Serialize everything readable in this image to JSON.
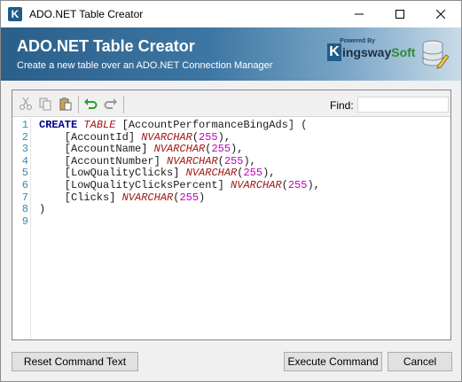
{
  "window": {
    "title": "ADO.NET Table Creator",
    "app_icon_letter": "K"
  },
  "banner": {
    "title": "ADO.NET Table Creator",
    "subtitle": "Create a new table over an ADO.NET Connection Manager",
    "logo_powered_by": "Powered By",
    "logo_brand_k": "K",
    "logo_brand_main": "ingsway",
    "logo_brand_soft": "Soft"
  },
  "toolbar": {
    "icons": [
      "cut-icon",
      "copy-icon",
      "paste-icon",
      "undo-icon",
      "redo-icon"
    ],
    "find_label": "Find:",
    "find_value": ""
  },
  "editor": {
    "line_numbers": [
      "1",
      "2",
      "3",
      "4",
      "5",
      "6",
      "7",
      "8",
      "9"
    ],
    "lines": [
      [
        {
          "t": "CREATE",
          "c": "kw"
        },
        {
          "t": " ",
          "c": ""
        },
        {
          "t": "TABLE",
          "c": "kw2"
        },
        {
          "t": " [AccountPerformanceBingAds] (",
          "c": ""
        }
      ],
      [
        {
          "t": "    [AccountId] ",
          "c": ""
        },
        {
          "t": "NVARCHAR",
          "c": "ty"
        },
        {
          "t": "(",
          "c": ""
        },
        {
          "t": "255",
          "c": "num"
        },
        {
          "t": "),",
          "c": ""
        }
      ],
      [
        {
          "t": "    [AccountName] ",
          "c": ""
        },
        {
          "t": "NVARCHAR",
          "c": "ty"
        },
        {
          "t": "(",
          "c": ""
        },
        {
          "t": "255",
          "c": "num"
        },
        {
          "t": "),",
          "c": ""
        }
      ],
      [
        {
          "t": "    [AccountNumber] ",
          "c": ""
        },
        {
          "t": "NVARCHAR",
          "c": "ty"
        },
        {
          "t": "(",
          "c": ""
        },
        {
          "t": "255",
          "c": "num"
        },
        {
          "t": "),",
          "c": ""
        }
      ],
      [
        {
          "t": "    [LowQualityClicks] ",
          "c": ""
        },
        {
          "t": "NVARCHAR",
          "c": "ty"
        },
        {
          "t": "(",
          "c": ""
        },
        {
          "t": "255",
          "c": "num"
        },
        {
          "t": "),",
          "c": ""
        }
      ],
      [
        {
          "t": "    [LowQualityClicksPercent] ",
          "c": ""
        },
        {
          "t": "NVARCHAR",
          "c": "ty"
        },
        {
          "t": "(",
          "c": ""
        },
        {
          "t": "255",
          "c": "num"
        },
        {
          "t": "),",
          "c": ""
        }
      ],
      [
        {
          "t": "    [Clicks] ",
          "c": ""
        },
        {
          "t": "NVARCHAR",
          "c": "ty"
        },
        {
          "t": "(",
          "c": ""
        },
        {
          "t": "255",
          "c": "num"
        },
        {
          "t": ")",
          "c": ""
        }
      ],
      [
        {
          "t": ")",
          "c": ""
        }
      ],
      []
    ]
  },
  "buttons": {
    "reset": "Reset Command Text",
    "execute": "Execute Command",
    "cancel": "Cancel"
  },
  "colors": {
    "keyword": "#00008b",
    "type": "#a31515",
    "number": "#c000c0",
    "line_number": "#2b91af",
    "banner_start": "#2b5f8a"
  }
}
